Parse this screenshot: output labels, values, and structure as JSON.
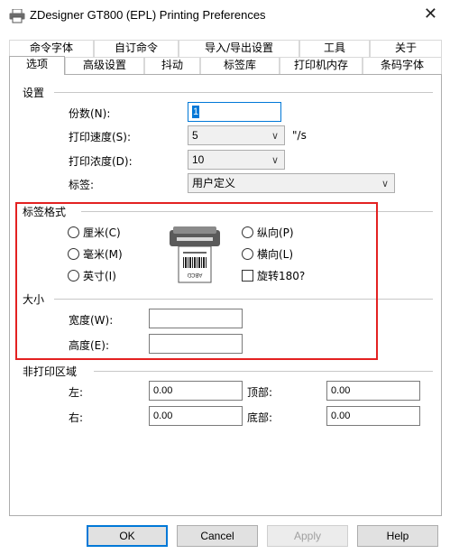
{
  "window": {
    "title": "ZDesigner GT800 (EPL) Printing Preferences",
    "close_glyph": "✕"
  },
  "tabs_row1": [
    "命令字体",
    "自订命令",
    "导入/导出设置",
    "工具",
    "关于"
  ],
  "tabs_row2": [
    "选项",
    "高级设置",
    "抖动",
    "标签库",
    "打印机内存",
    "条码字体"
  ],
  "settings": {
    "group_label": "设置",
    "copies_label": "份数(N):",
    "copies_value": "1",
    "speed_label": "打印速度(S):",
    "speed_value": "5",
    "speed_unit": "\"/s",
    "darkness_label": "打印浓度(D):",
    "darkness_value": "10",
    "label_label": "标签:",
    "label_value": "用户定义"
  },
  "label_format": {
    "group_label": "标签格式",
    "unit_cm": "厘米(C)",
    "unit_mm": "毫米(M)",
    "unit_inch": "英寸(I)",
    "portrait": "纵向(P)",
    "landscape": "横向(L)",
    "rotate": "旋转180?"
  },
  "size": {
    "group_label": "大小",
    "width_label": "宽度(W):",
    "width_value": "",
    "height_label": "高度(E):",
    "height_value": ""
  },
  "unprintable": {
    "group_label": "非打印区域",
    "left_label": "左:",
    "left_value": "0.00",
    "top_label": "顶部:",
    "top_value": "0.00",
    "right_label": "右:",
    "right_value": "0.00",
    "bottom_label": "底部:",
    "bottom_value": "0.00"
  },
  "buttons": {
    "ok": "OK",
    "cancel": "Cancel",
    "apply": "Apply",
    "help": "Help"
  },
  "printer_label_text": "ABCD",
  "colors": {
    "highlight": "#e32121",
    "focus": "#0078d7"
  }
}
